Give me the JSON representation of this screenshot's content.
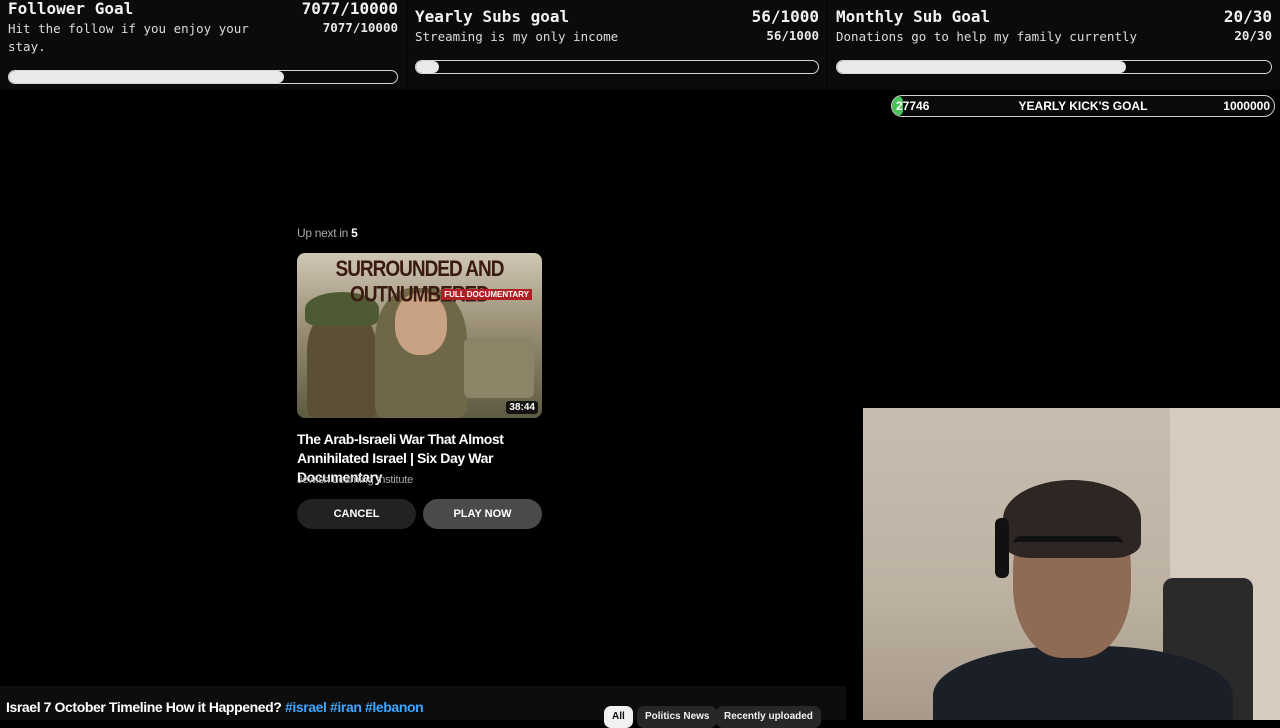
{
  "goals": {
    "follower": {
      "title": "Follower Goal",
      "count": "7077/10000",
      "description": "Hit the follow if you enjoy your stay.",
      "progress": 0.7077
    },
    "yearly_subs": {
      "title": "Yearly Subs goal",
      "count": "56/1000",
      "description": "Streaming is my only income",
      "progress": 0.056
    },
    "monthly_sub": {
      "title": "Monthly Sub Goal",
      "count": "20/30",
      "description": "Donations go to help my family currently",
      "progress": 0.667
    }
  },
  "kick_goal": {
    "current": "27746",
    "title": "YEARLY KICK'S GOAL",
    "target": "1000000",
    "progress": 0.027746,
    "fill_color": "#4cc35a"
  },
  "endscreen": {
    "up_next_prefix": "Up next in",
    "countdown": "5",
    "thumbnail": {
      "headline": "SURROUNDED AND OUTNUMBERED",
      "badge": "FULL DOCUMENTARY",
      "duration": "38:44"
    },
    "video_title": "The Arab-Israeli War That Almost Annihilated Israel | Six Day War Documentary",
    "channel": "Jewish Learning Institute",
    "cancel_label": "CANCEL",
    "play_label": "PLAY NOW"
  },
  "bottom_bar": {
    "title_text": "Israel 7 October Timeline How it Happened?",
    "hashtags": [
      "#israel",
      "#iran",
      "#lebanon"
    ],
    "chips": [
      "All",
      "Politics News",
      "Recently uploaded"
    ]
  },
  "colors": {
    "hashtag": "#3ea6ff",
    "background": "#000000"
  }
}
